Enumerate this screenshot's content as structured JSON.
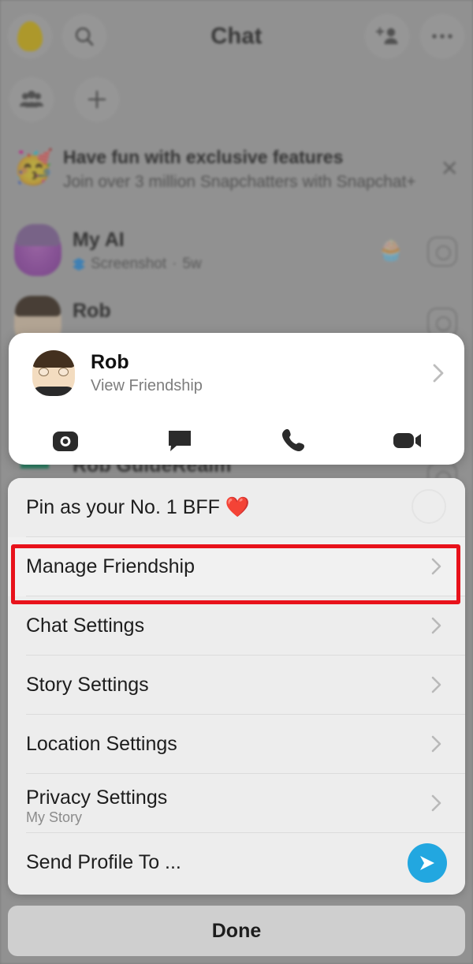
{
  "header": {
    "title": "Chat",
    "icons": {
      "profile": "bitmoji-avatar-icon",
      "search": "search-icon",
      "groups": "group-friends-icon",
      "new_chat": "plus-icon",
      "add_friend": "add-friend-icon",
      "more": "more-options-icon"
    }
  },
  "promo": {
    "emoji": "🥳",
    "title": "Have fun with exclusive features",
    "subtitle": "Join over 3 million Snapchatters with Snapchat+",
    "close_label": "✕"
  },
  "chat_list": [
    {
      "name": "My AI",
      "status": "Screenshot",
      "time": "5w",
      "separator": "·",
      "emoji": "🧁"
    },
    {
      "name": "Rob",
      "status": "",
      "time": "",
      "separator": "",
      "emoji": ""
    },
    {
      "name": "Rob GuideRealm",
      "status": "",
      "time": "",
      "separator": "",
      "emoji": ""
    }
  ],
  "profile_card": {
    "name": "Rob",
    "subtitle": "View Friendship",
    "chevron": "chevron-right-icon",
    "actions": [
      {
        "name": "camera-action",
        "icon": "camera-icon"
      },
      {
        "name": "chat-action",
        "icon": "chat-bubble-icon"
      },
      {
        "name": "call-action",
        "icon": "phone-icon"
      },
      {
        "name": "video-action",
        "icon": "video-camera-icon"
      }
    ]
  },
  "sheet": {
    "rows": [
      {
        "label": "Pin as your No. 1 BFF ❤️",
        "sub": "",
        "accessory": "circle"
      },
      {
        "label": "Manage Friendship",
        "sub": "",
        "accessory": "chevron",
        "highlighted": true
      },
      {
        "label": "Chat Settings",
        "sub": "",
        "accessory": "chevron"
      },
      {
        "label": "Story Settings",
        "sub": "",
        "accessory": "chevron"
      },
      {
        "label": "Location Settings",
        "sub": "",
        "accessory": "chevron"
      },
      {
        "label": "Privacy Settings",
        "sub": "My Story",
        "accessory": "chevron"
      },
      {
        "label": "Send Profile To ...",
        "sub": "",
        "accessory": "send"
      }
    ]
  },
  "done_button": {
    "label": "Done"
  },
  "colors": {
    "backdrop": "#8c8c8c",
    "sheet_bg": "#ededed",
    "card_bg": "#ffffff",
    "highlight": "#e8121b",
    "send_blue": "#22a7e0",
    "snap_yellow": "#e8c40a",
    "done_bg": "#cfcfcf"
  }
}
